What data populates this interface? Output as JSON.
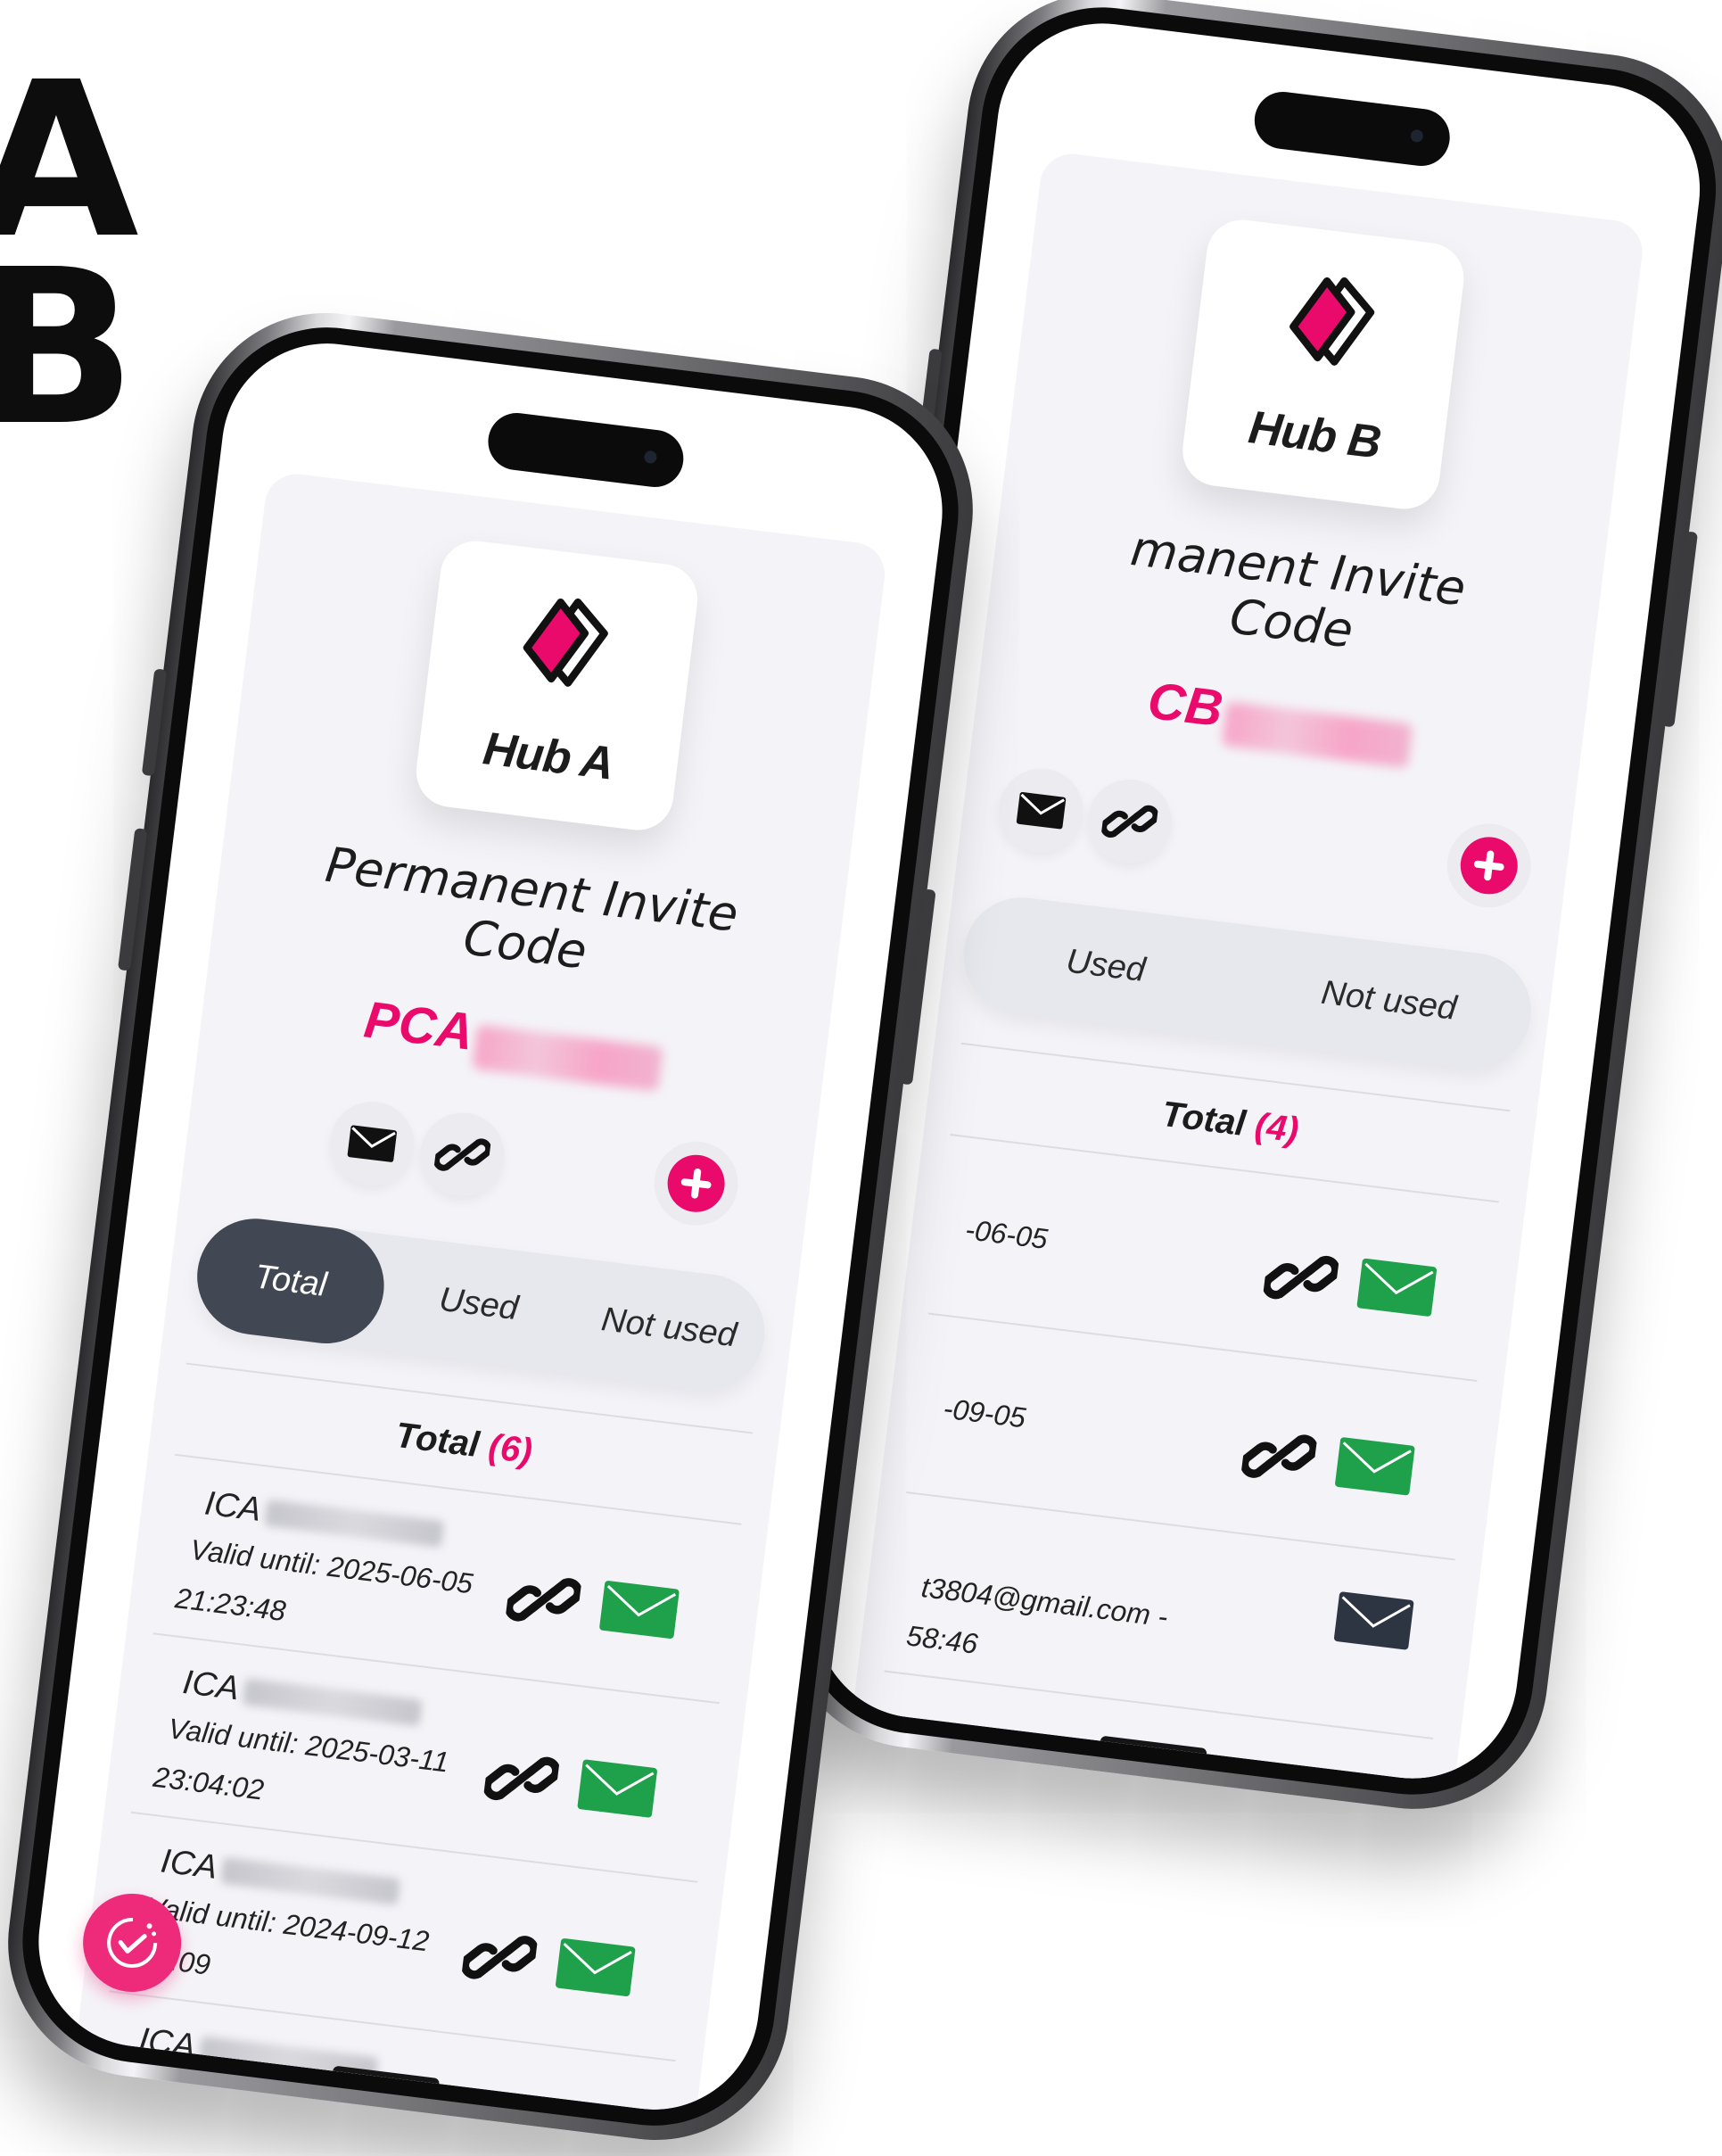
{
  "background_letters": [
    "A",
    "B"
  ],
  "colors": {
    "accent": "#ea0a6b",
    "tab_active": "#414853",
    "mail_green": "#1fa04a",
    "mail_dark": "#2d3542",
    "card_bg": "#f4f4f8"
  },
  "hub_a": {
    "hub_name": "Hub A",
    "invite_title_line1": "Permanent Invite",
    "invite_title_line2": "Code",
    "code_prefix": "PCA",
    "tabs": [
      "Total",
      "Used",
      "Not used"
    ],
    "active_tab": "Total",
    "total_label": "Total",
    "total_count": "(6)",
    "invites": [
      {
        "code_prefix": "ICA",
        "valid_label": "Valid until: 2025-06-05",
        "time": "21:23:48",
        "mail": "green"
      },
      {
        "code_prefix": "ICA",
        "valid_label": "Valid until: 2025-03-11",
        "time": "23:04:02",
        "mail": "green"
      },
      {
        "code_prefix": "ICA",
        "valid_label": "Valid until: 2024-09-12",
        "time": ":34:09",
        "mail": "green"
      },
      {
        "code_prefix": "ICA",
        "valid_label": "",
        "time": "",
        "mail": "green"
      }
    ]
  },
  "hub_b": {
    "hub_name": "Hub B",
    "invite_title_line1": "manent Invite",
    "invite_title_line2": "Code",
    "code_prefix": "CB",
    "tabs": [
      "Used",
      "Not used"
    ],
    "total_label": "Total",
    "total_count": "(4)",
    "invites": [
      {
        "valid_label": "-06-05",
        "mail": "green"
      },
      {
        "valid_label": "-09-05",
        "mail": "green"
      },
      {
        "valid_label": "t3804@gmail.com -",
        "time": "58:46",
        "mail": "dark"
      }
    ]
  },
  "icons": [
    "hub-logo-icon",
    "mail-icon",
    "link-icon",
    "plus-icon",
    "checklist-fab-icon"
  ]
}
